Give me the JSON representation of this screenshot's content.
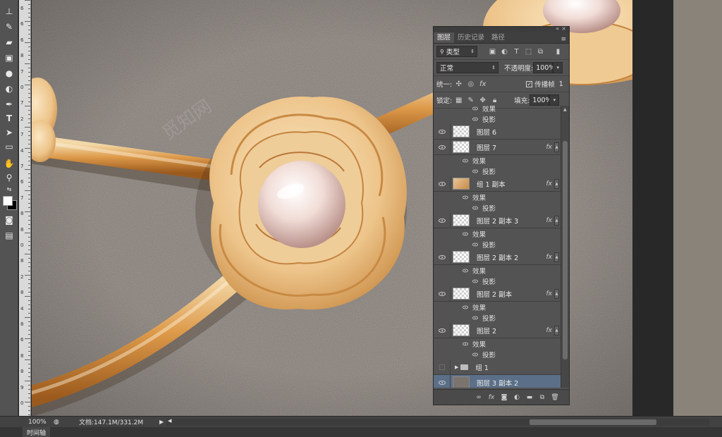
{
  "status": {
    "zoom": "100%",
    "doc_info": "文档:147.1M/331.2M"
  },
  "timeline_tab": "时间轴",
  "ruler": {
    "ticks": [
      "6",
      "6",
      "6",
      "8",
      "7",
      "0",
      "7",
      "2",
      "7",
      "4",
      "7",
      "6",
      "7",
      "8",
      "8",
      "0",
      "8",
      "2",
      "8",
      "4",
      "8",
      "6",
      "8",
      "8",
      "9",
      "0"
    ]
  },
  "watermark": "觅知网",
  "panel": {
    "tabs": [
      "图层",
      "历史记录",
      "路径"
    ],
    "active_tab": 0,
    "filter": {
      "label": "类型",
      "icon": "search-icon"
    },
    "blend_mode": "正常",
    "opacity_label": "不透明度:",
    "opacity_value": "100%",
    "unify_label": "统一:",
    "propagate_label": "传播帧",
    "propagate_value": "1",
    "lock_label": "锁定:",
    "fill_label": "填充:",
    "fill_value": "100%",
    "layers": [
      {
        "kind": "sub2",
        "text": "效果"
      },
      {
        "kind": "sub2",
        "text": "投影"
      },
      {
        "kind": "layer",
        "name": "图层 6",
        "thumb": "checker",
        "fx": ""
      },
      {
        "kind": "layer",
        "name": "图层 7",
        "thumb": "checker",
        "fx": "fx"
      },
      {
        "kind": "sub1",
        "text": "效果"
      },
      {
        "kind": "sub2",
        "text": "投影"
      },
      {
        "kind": "layer",
        "name": "组 1 副本",
        "thumb": "img",
        "fx": "fx"
      },
      {
        "kind": "sub1",
        "text": "效果"
      },
      {
        "kind": "sub2",
        "text": "投影"
      },
      {
        "kind": "layer",
        "name": "图层 2 副本 3",
        "thumb": "checker",
        "fx": "fx"
      },
      {
        "kind": "sub1",
        "text": "效果"
      },
      {
        "kind": "sub2",
        "text": "投影"
      },
      {
        "kind": "layer",
        "name": "图层 2 副本 2",
        "thumb": "checker",
        "fx": "fx"
      },
      {
        "kind": "sub1",
        "text": "效果"
      },
      {
        "kind": "sub2",
        "text": "投影"
      },
      {
        "kind": "layer",
        "name": "图层 2 副本",
        "thumb": "checker",
        "fx": "fx"
      },
      {
        "kind": "sub1",
        "text": "效果"
      },
      {
        "kind": "sub2",
        "text": "投影"
      },
      {
        "kind": "layer",
        "name": "图层 2",
        "thumb": "checker",
        "fx": "fx"
      },
      {
        "kind": "sub1",
        "text": "效果"
      },
      {
        "kind": "sub2",
        "text": "投影"
      },
      {
        "kind": "group",
        "name": "组 1",
        "thumb": "",
        "fx": ""
      },
      {
        "kind": "layer",
        "name": "图层 3 副本 2",
        "thumb": "gray",
        "fx": "",
        "selected": true
      }
    ]
  }
}
